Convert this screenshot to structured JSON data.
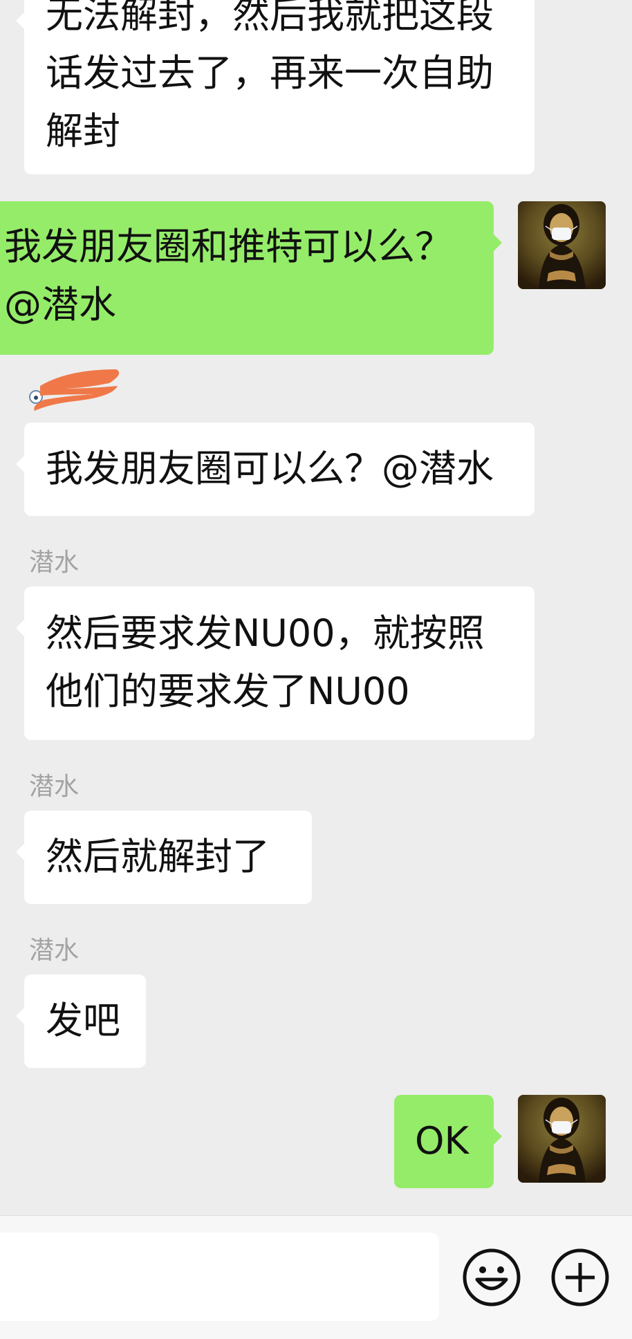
{
  "messages": [
    {
      "sender": "",
      "text": "无法解封，然后我就把这段\n话发过去了，再来一次自助\n解封"
    },
    {
      "sender": "",
      "text": "我发朋友圈和推特可以么？\n@潜水"
    },
    {
      "sender": "",
      "text": "我发朋友圈可以么？@潜水"
    },
    {
      "sender": "潜水",
      "text": "然后要求发NU00，就按照\n他们的要求发了NU00"
    },
    {
      "sender": "潜水",
      "text": "然后就解封了"
    },
    {
      "sender": "潜水",
      "text": "发吧"
    },
    {
      "sender": "",
      "text": "OK"
    }
  ],
  "input": {
    "placeholder": "",
    "value": ""
  },
  "icons": {
    "emoji": "emoji-icon",
    "add": "plus-circle-icon",
    "avatar": "mona-lisa-avatar"
  },
  "colors": {
    "chat_background": "#ededed",
    "incoming_bubble": "#ffffff",
    "outgoing_bubble": "#95ec69",
    "sender_name": "#a3a3a3",
    "redaction": "#f07848"
  }
}
